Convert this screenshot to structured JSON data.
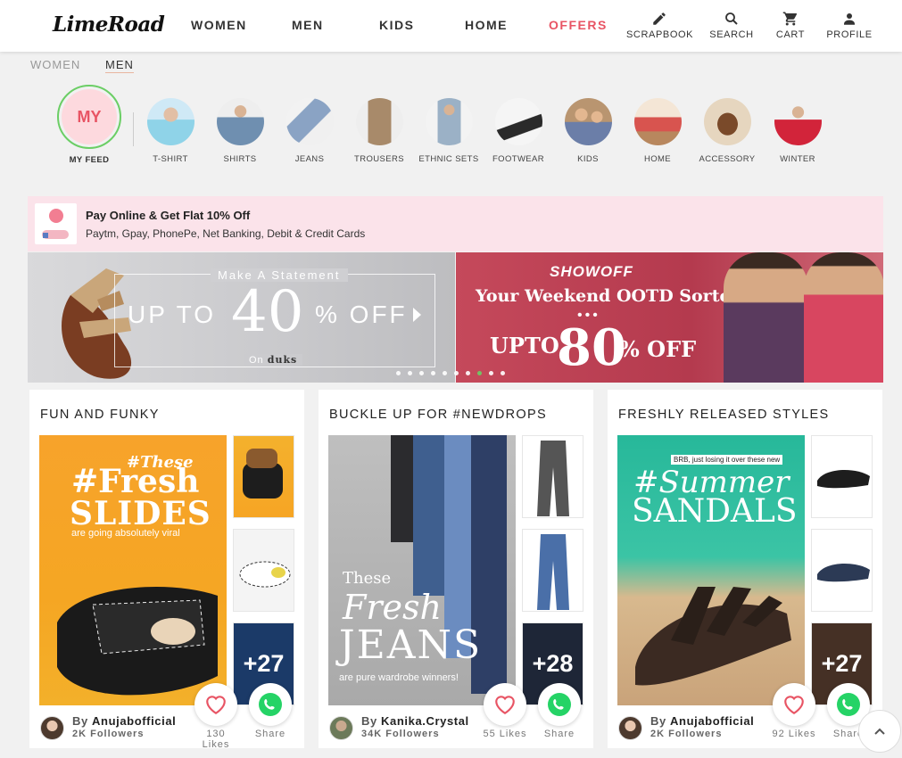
{
  "header": {
    "logo": "LimeRoad",
    "nav": [
      "WOMEN",
      "MEN",
      "KIDS",
      "HOME",
      "OFFERS"
    ],
    "tools": [
      "SCRAPBOOK",
      "SEARCH",
      "CART",
      "PROFILE"
    ]
  },
  "tabs": [
    "WOMEN",
    "MEN"
  ],
  "active_tab": "MEN",
  "categories": {
    "myfeed_badge": "MY",
    "myfeed_label": "MY FEED",
    "items": [
      "T-SHIRT",
      "SHIRTS",
      "JEANS",
      "TROUSERS",
      "ETHNIC SETS",
      "FOOTWEAR",
      "KIDS",
      "HOME",
      "ACCESSORY",
      "WINTER"
    ]
  },
  "payment": {
    "title": "Pay Online & Get Flat 10% Off",
    "subtitle": "Paytm, Gpay, PhonePe, Net Banking, Debit & Credit Cards"
  },
  "hero": {
    "left": {
      "caption": "Make A Statement",
      "upto": "UP TO",
      "value": "40",
      "off": "% OFF",
      "on": "On",
      "brand": "duks"
    },
    "right": {
      "brand": "SHOWOFF",
      "tagline": "Your Weekend OOTD Sorted",
      "dots": "•••",
      "upto": "UPTO",
      "value": "80",
      "off": "% OFF"
    },
    "pager_count": 10,
    "pager_active": 8
  },
  "cards": [
    {
      "title": "FUN AND FUNKY",
      "main_line1": "#These",
      "main_line2": "#Fresh",
      "main_line3": "SLIDES",
      "main_sub": "are going absolutely viral",
      "more": "+27",
      "by": "By",
      "author": "Anujabofficial",
      "followers": "2K Followers",
      "likes": "130 Likes",
      "share": "Share"
    },
    {
      "title": "BUCKLE UP FOR #NEWDROPS",
      "main_line1": "These",
      "main_line2": "Fresh",
      "main_line3": "JEANS",
      "main_sub": "are pure wardrobe winners!",
      "more": "+28",
      "by": "By",
      "author": "Kanika.Crystal",
      "followers": "34K Followers",
      "likes": "55 Likes",
      "share": "Share"
    },
    {
      "title": "FRESHLY RELEASED STYLES",
      "main_line1": "BRB, just losing it over these new",
      "main_line2": "#Summer",
      "main_line3": "SANDALS",
      "main_sub": "",
      "more": "+27",
      "by": "By",
      "author": "Anujabofficial",
      "followers": "2K Followers",
      "likes": "92 Likes",
      "share": "Share"
    }
  ],
  "colors": {
    "accent": "#e85464",
    "green": "#6bce65",
    "pink_banner": "#fbe3ea"
  }
}
